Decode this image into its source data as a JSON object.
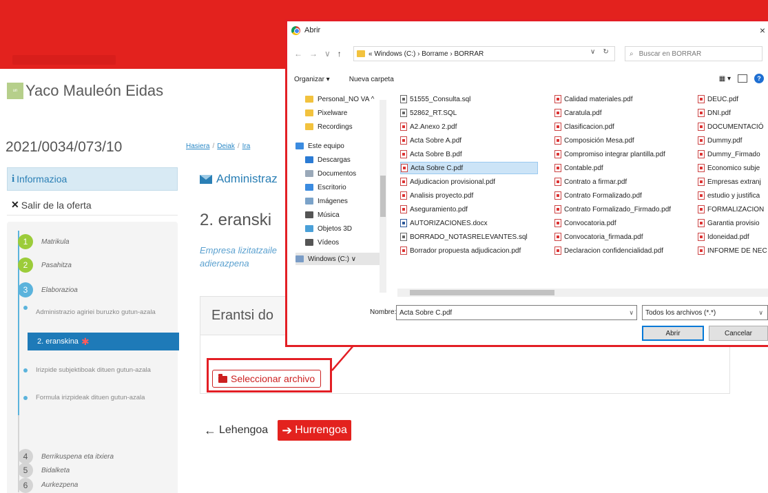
{
  "user": {
    "name": "Yaco Mauleón Eidas",
    "logo_text": "un"
  },
  "expedient_id": "2021/0034/073/10",
  "breadcrumb": [
    "Hasiera",
    "Deiak",
    "Ira"
  ],
  "sidebar": {
    "info_label": "Informazioa",
    "exit_label": "Salir de la oferta",
    "steps": [
      {
        "num": "1",
        "label": "Matrikula"
      },
      {
        "num": "2",
        "label": "Pasahitza"
      },
      {
        "num": "3",
        "label": "Elaborazioa"
      },
      {
        "num": "4",
        "label": "Berrikuspena eta itxiera"
      },
      {
        "num": "5",
        "label": "Bidalketa"
      },
      {
        "num": "6",
        "label": "Aurkezpena"
      }
    ],
    "substeps": [
      "Administrazio agiriei buruzko gutun-azala",
      "2. eranskina",
      "Irizpide subjektiboak dituen gutun-azala",
      "Formula irizpideak dituen gutun-azala"
    ]
  },
  "main": {
    "section_title": "Administraz",
    "page_title": "2. eranski",
    "subtitle": "Empresa lizitatzaile adierazpena",
    "panel_title": "Erantsi do",
    "select_button": "Seleccionar archivo",
    "prev_button": "Lehengoa",
    "next_button": "Hurrengoa"
  },
  "dialog": {
    "title": "Abrir",
    "close": "×",
    "path": "« Windows (C:)  ›  Borrame  ›  BORRAR",
    "search_placeholder": "Buscar en BORRAR",
    "organize": "Organizar ▾",
    "new_folder": "Nueva carpeta",
    "nav_items": [
      {
        "label": "Personal_NO VA ^",
        "color": "#f2c23e"
      },
      {
        "label": "Pixelware",
        "color": "#f2c23e"
      },
      {
        "label": "Recordings",
        "color": "#f2c23e"
      },
      {
        "label": "Este equipo",
        "color": "#3b8be0"
      },
      {
        "label": "Descargas",
        "color": "#2b7bd4"
      },
      {
        "label": "Documentos",
        "color": "#9aa9b9"
      },
      {
        "label": "Escritorio",
        "color": "#3b8be0"
      },
      {
        "label": "Imágenes",
        "color": "#7ba3c9"
      },
      {
        "label": "Música",
        "color": "#555555"
      },
      {
        "label": "Objetos 3D",
        "color": "#4aa0d8"
      },
      {
        "label": "Vídeos",
        "color": "#555555"
      },
      {
        "label": "Windows (C:)     ∨",
        "color": "#7a9cc6"
      }
    ],
    "files_col1": [
      "51555_Consulta.sql",
      "52862_RT.SQL",
      "A2.Anexo 2.pdf",
      "Acta Sobre A.pdf",
      "Acta Sobre B.pdf",
      "Acta Sobre C.pdf",
      "Adjudicacion provisional.pdf",
      "Analisis proyecto.pdf",
      "Aseguramiento.pdf",
      "AUTORIZACIONES.docx",
      "BORRADO_NOTASRELEVANTES.sql",
      "Borrador propuesta adjudicacion.pdf"
    ],
    "files_col2": [
      "Calidad materiales.pdf",
      "Caratula.pdf",
      "Clasificacion.pdf",
      "Composición Mesa.pdf",
      "Compromiso integrar plantilla.pdf",
      "Contable.pdf",
      "Contrato a firmar.pdf",
      "Contrato Formalizado.pdf",
      "Contrato Formalizado_Firmado.pdf",
      "Convocatoria.pdf",
      "Convocatoria_firmada.pdf",
      "Declaracion confidencialidad.pdf"
    ],
    "files_col3": [
      "DEUC.pdf",
      "DNI.pdf",
      "DOCUMENTACIÓ",
      "Dummy.pdf",
      "Dummy_Firmado",
      "Economico subje",
      "Empresas extranj",
      "estudio y justifica",
      "FORMALIZACION",
      "Garantia provisio",
      "Idoneidad.pdf",
      "INFORME DE NEC"
    ],
    "name_label": "Nombre:",
    "name_value": "Acta Sobre C.pdf",
    "type_value": "Todos los archivos (*.*)",
    "open_button": "Abrir",
    "cancel_button": "Cancelar"
  }
}
